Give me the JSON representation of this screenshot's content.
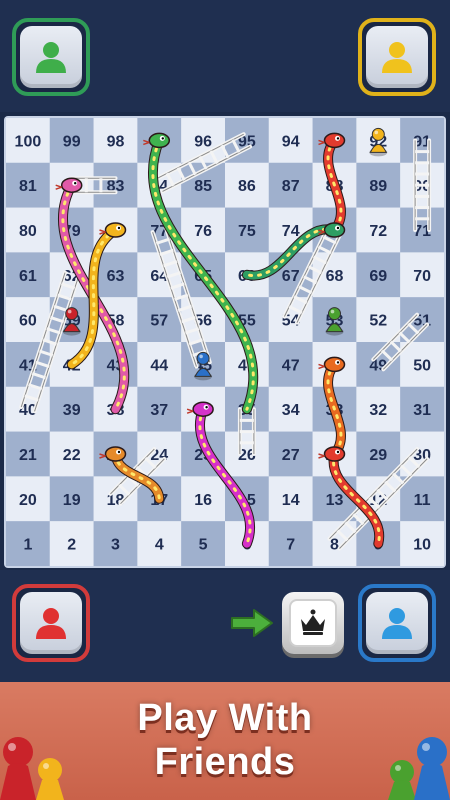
{
  "board": {
    "rows": [
      [
        100,
        99,
        98,
        97,
        96,
        95,
        94,
        93,
        92,
        91
      ],
      [
        81,
        82,
        83,
        84,
        85,
        86,
        87,
        88,
        89,
        90
      ],
      [
        80,
        79,
        78,
        77,
        76,
        75,
        74,
        73,
        72,
        71
      ],
      [
        61,
        62,
        63,
        64,
        65,
        66,
        67,
        68,
        69,
        70
      ],
      [
        60,
        59,
        58,
        57,
        56,
        55,
        54,
        53,
        52,
        51
      ],
      [
        41,
        42,
        43,
        44,
        45,
        46,
        47,
        48,
        49,
        50
      ],
      [
        40,
        39,
        38,
        37,
        36,
        35,
        34,
        33,
        32,
        31
      ],
      [
        21,
        22,
        23,
        24,
        25,
        26,
        27,
        28,
        29,
        30
      ],
      [
        20,
        19,
        18,
        17,
        16,
        15,
        14,
        13,
        12,
        11
      ],
      [
        1,
        2,
        3,
        4,
        5,
        6,
        7,
        8,
        9,
        10
      ]
    ],
    "colors": {
      "light": "#e8edf6",
      "dark": "#9fb0cd",
      "number": "#1f2d52"
    },
    "snakes": [
      {
        "color": "#3fb34f",
        "head": 97,
        "tail": 35
      },
      {
        "color": "#e23b2e",
        "head": 93,
        "tail": 73
      },
      {
        "color": "#e05aa8",
        "head": 82,
        "tail": 38
      },
      {
        "color": "#f2b41c",
        "head": 78,
        "tail": 42
      },
      {
        "color": "#2e9e63",
        "head": 73,
        "tail": 66
      },
      {
        "color": "#e86a20",
        "head": 48,
        "tail": 28
      },
      {
        "color": "#d531c8",
        "head": 36,
        "tail": 6
      },
      {
        "color": "#e58a2a",
        "head": 23,
        "tail": 17
      },
      {
        "color": "#e23b2e",
        "head": 28,
        "tail": 9
      }
    ],
    "ladders": [
      {
        "from": 40,
        "to": 62
      },
      {
        "from": 18,
        "to": 24
      },
      {
        "from": 26,
        "to": 35
      },
      {
        "from": 8,
        "to": 30
      },
      {
        "from": 45,
        "to": 77
      },
      {
        "from": 54,
        "to": 73
      },
      {
        "from": 49,
        "to": 51
      },
      {
        "from": 71,
        "to": 91
      },
      {
        "from": 84,
        "to": 95
      },
      {
        "from": 82,
        "to": 83
      }
    ],
    "pawns": [
      {
        "color": "#f2b41c",
        "cell": 92
      },
      {
        "color": "#c9232a",
        "cell": 59
      },
      {
        "color": "#4aa12f",
        "cell": 53
      },
      {
        "color": "#2a70c8",
        "cell": 45
      }
    ]
  },
  "players": {
    "top_left": {
      "color": "#3fae4a",
      "border": "#2f9c57"
    },
    "top_right": {
      "color": "#f0c21d",
      "border": "#e0b21a"
    },
    "bottom_left": {
      "color": "#e03131",
      "border": "#d23b3b"
    },
    "bottom_right": {
      "color": "#2f9ae0",
      "border": "#2a79c9"
    }
  },
  "turn_arrow_color": "#4caf3c",
  "dice": {
    "icon": "crown-icon"
  },
  "banner": {
    "title_line1": "Play With",
    "title_line2": "Friends"
  }
}
